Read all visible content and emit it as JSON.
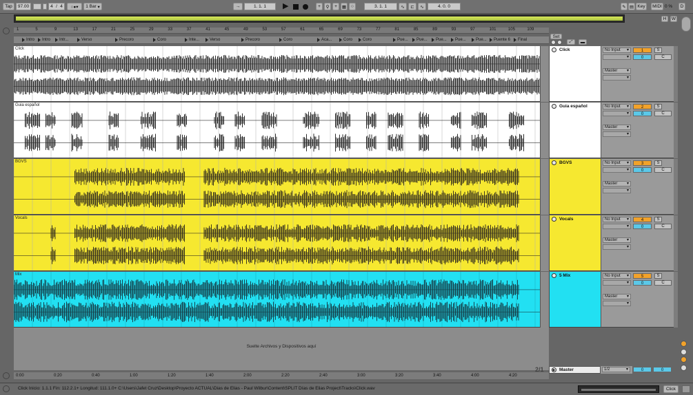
{
  "transport": {
    "tap": "Tap",
    "tempo": "97.00",
    "meter_num": "4",
    "slash": "/",
    "meter_den": "4",
    "quantize": "1 Bar",
    "position": "1.   1.   1",
    "loop_start": "3.   1.   1",
    "loop_length": "4.   0.   0",
    "key": "Key",
    "midi": "MIDI",
    "cpu": "0 %",
    "d": "D",
    "h": "H",
    "w": "W",
    "set": "Set"
  },
  "ruler": {
    "bars": [
      "1",
      "5",
      "9",
      "13",
      "17",
      "21",
      "25",
      "29",
      "33",
      "37",
      "41",
      "45",
      "49",
      "53",
      "57",
      "61",
      "65",
      "69",
      "73",
      "77",
      "81",
      "85",
      "89",
      "93",
      "97",
      "101",
      "105",
      "109"
    ]
  },
  "locators": [
    {
      "label": "Intro"
    },
    {
      "label": "Intro"
    },
    {
      "label": "Intr..."
    },
    {
      "label": "Verso"
    },
    {
      "label": "Precoro"
    },
    {
      "label": "Coro"
    },
    {
      "label": "Inte..."
    },
    {
      "label": "Verso"
    },
    {
      "label": "Precoro"
    },
    {
      "label": "Coro"
    },
    {
      "label": "Aca..."
    },
    {
      "label": "Coro"
    },
    {
      "label": "Coro"
    },
    {
      "label": "Pue..."
    },
    {
      "label": "Pue..."
    },
    {
      "label": "Pue..."
    },
    {
      "label": "Pue..."
    },
    {
      "label": "Pue..."
    },
    {
      "label": "Puente 6"
    },
    {
      "label": "Final"
    }
  ],
  "tracks": [
    {
      "clip": "Click",
      "name": "Click",
      "input": "No Input",
      "output": "Master",
      "number": "1",
      "pan": "0",
      "solo": "S",
      "cue": "C",
      "color": "#ffffff",
      "wave": "#2a2a2a"
    },
    {
      "clip": "Guia español",
      "name": "Guia español",
      "input": "No Input",
      "output": "Master",
      "number": "2",
      "pan": "0",
      "solo": "S",
      "cue": "C",
      "color": "#ffffff",
      "wave": "#2a2a2a"
    },
    {
      "clip": "BGVS",
      "name": "BGVS",
      "input": "No Input",
      "output": "Master",
      "number": "3",
      "pan": "0",
      "solo": "S",
      "cue": "C",
      "color": "#f6e830",
      "wave": "#3a3420"
    },
    {
      "clip": "Vocals",
      "name": "Vocals",
      "input": "No Input",
      "output": "Master",
      "number": "4",
      "pan": "0",
      "solo": "S",
      "cue": "C",
      "color": "#f6e830",
      "wave": "#3a3420"
    },
    {
      "clip": "Mix",
      "name": "5 Mix",
      "input": "No Input",
      "output": "Master",
      "number": "5",
      "pan": "0",
      "solo": "S",
      "cue": "C",
      "color": "#22e0f2",
      "wave": "#16404a"
    }
  ],
  "dropzone": "Suelte Archivos y Dispositivos aquí",
  "timeline": {
    "labels": [
      "0:00",
      "0:20",
      "0:40",
      "1:00",
      "1:20",
      "1:40",
      "2:00",
      "2:20",
      "2:40",
      "3:00",
      "3:20",
      "3:40",
      "4:00",
      "4:20"
    ],
    "page": "2/1"
  },
  "master": {
    "name": "Master",
    "output": "1/2",
    "pan": "0",
    "vol": "0"
  },
  "status": {
    "text": "Click  Inicio: 1.1.1  Fin: 112.2.1+  Longitud: 111.1.0+  C:\\Users\\Jafet Cruz\\Desktop\\Proyecto ACTUAL\\Dias de Elias - Paul Wilbur\\Content\\SPLIT Días de Elias Project\\Tracks\\Click.wav",
    "right_label": "Click"
  },
  "colors": {
    "accent_orange": "#f2a22a",
    "accent_blue": "#5bc8e8"
  }
}
